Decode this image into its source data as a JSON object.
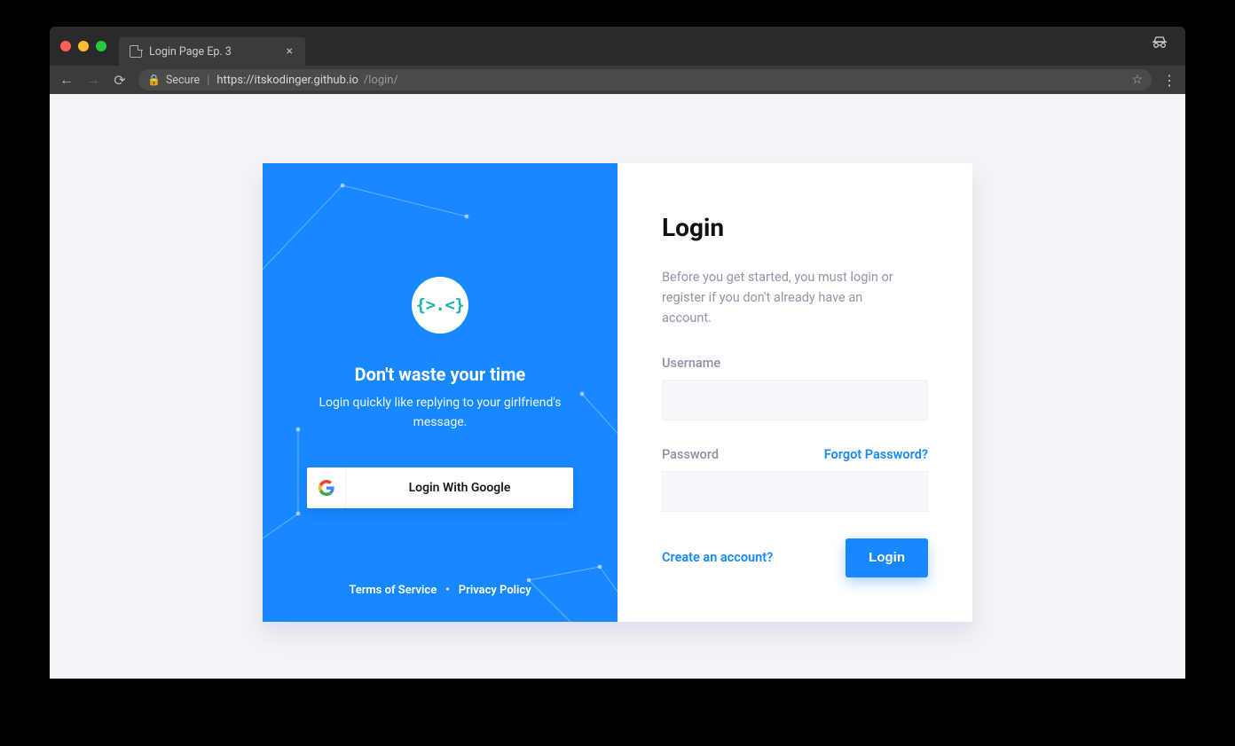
{
  "browser": {
    "tab_title": "Login Page Ep. 3",
    "secure_label": "Secure",
    "url_scheme_host": "https://itskodinger.github.io",
    "url_path": "/login/"
  },
  "left": {
    "logo_text": "{>.<}",
    "heading": "Don't waste your time",
    "subtext": "Login quickly like replying to your girlfriend's message.",
    "google_button": "Login With Google",
    "terms": "Terms of Service",
    "privacy": "Privacy Policy"
  },
  "right": {
    "heading": "Login",
    "intro": "Before you get started, you must login or register if you don't already have an account.",
    "username_label": "Username",
    "password_label": "Password",
    "forgot": "Forgot Password?",
    "create": "Create an account?",
    "login_button": "Login"
  }
}
